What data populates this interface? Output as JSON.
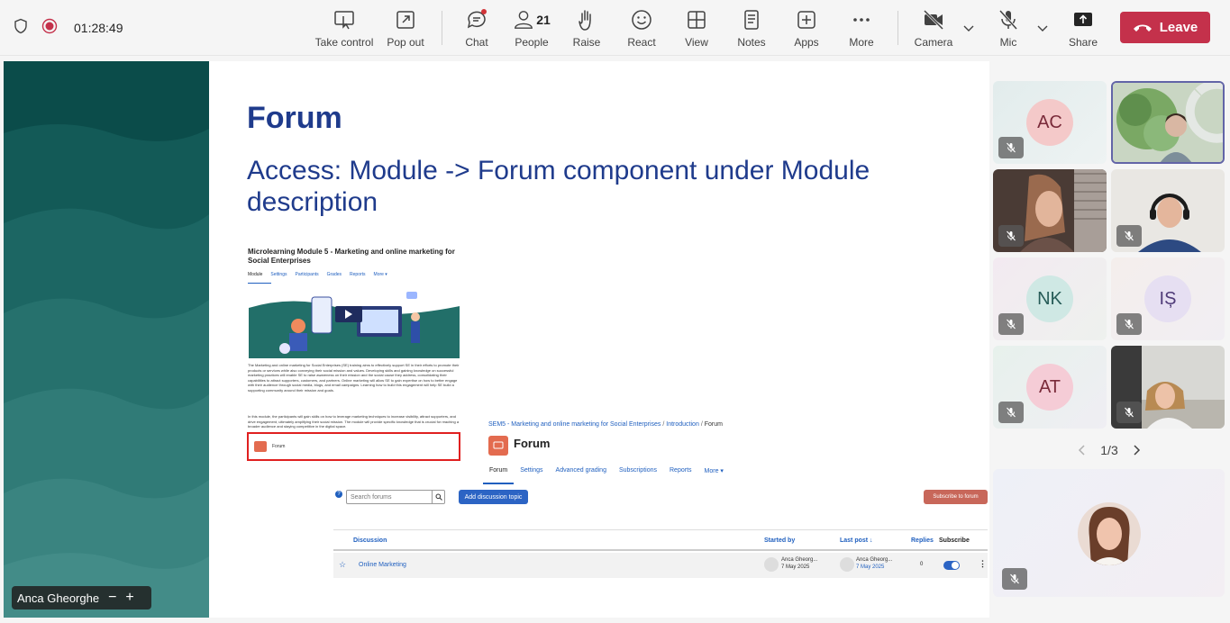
{
  "meeting": {
    "timer": "01:28:49"
  },
  "toolbar": {
    "take_control": "Take control",
    "pop_out": "Pop out",
    "chat": "Chat",
    "people": "People",
    "people_count": "21",
    "raise": "Raise",
    "react": "React",
    "view": "View",
    "notes": "Notes",
    "apps": "Apps",
    "more": "More",
    "camera": "Camera",
    "mic": "Mic",
    "share": "Share",
    "leave": "Leave"
  },
  "slide": {
    "title": "Forum",
    "subtitle": "Access: Module -> Forum component under Module description",
    "shot1": {
      "heading": "Microlearning Module 5 - Marketing and online marketing for Social Enterprises",
      "tabs": [
        "Module",
        "Settings",
        "Participants",
        "Grades",
        "Reports",
        "More ▾"
      ],
      "paragraph1": "The Marketing and online marketing for Social Enterprises (SE) training aims to effectively support SE in their efforts to promote their products or services while also conveying their social mission and values. Developing skills and gaining knowledge on successful marketing practices will enable SE to raise awareness on their mission and the social cause they address, consolidating their capabilities to attract supporters, customers, and partners. Online marketing will allow SE to gain expertise on how to better engage with their audience through social media, blogs, and email campaigns. Learning how to build this engagement will help SE build a supporting community around their mission and goals.",
      "paragraph2": "In this module, the participants will gain skills on how to leverage marketing techniques to increase visibility, attract supporters, and drive engagement, ultimately amplifying their social mission. The module will provide specific knowledge that is crucial for reaching a broader audience and staying competitive in the digital space.",
      "forum_label": "Forum"
    },
    "shot2": {
      "breadcrumb": [
        "SEM5 - Marketing and online marketing for Social Enterprises",
        "Introduction",
        "Forum"
      ],
      "title": "Forum",
      "tabs": [
        "Forum",
        "Settings",
        "Advanced grading",
        "Subscriptions",
        "Reports",
        "More ▾"
      ],
      "search_placeholder": "Search forums",
      "add_topic": "Add discussion topic",
      "subscribe": "Subscribe to forum",
      "columns": [
        "Discussion",
        "Started by",
        "Last post ↓",
        "Replies",
        "Subscribe"
      ],
      "row": {
        "discussion": "Online Marketing",
        "started_by": "Anca Gheorg...",
        "started_date": "7 May 2025",
        "last_by": "Anca Gheorg...",
        "last_date": "7 May 2025",
        "replies": "0"
      }
    }
  },
  "presenter": {
    "name": "Anca Gheorghe"
  },
  "participants": [
    {
      "initials": "AC",
      "bg": "#f4c9c9"
    },
    {
      "initials": "NK",
      "bg": "#cfe8e4"
    },
    {
      "initials": "IȘ",
      "bg": "#e6dff2"
    },
    {
      "initials": "AT",
      "bg": "#f5ccd6"
    }
  ],
  "pager": {
    "text": "1/3"
  }
}
